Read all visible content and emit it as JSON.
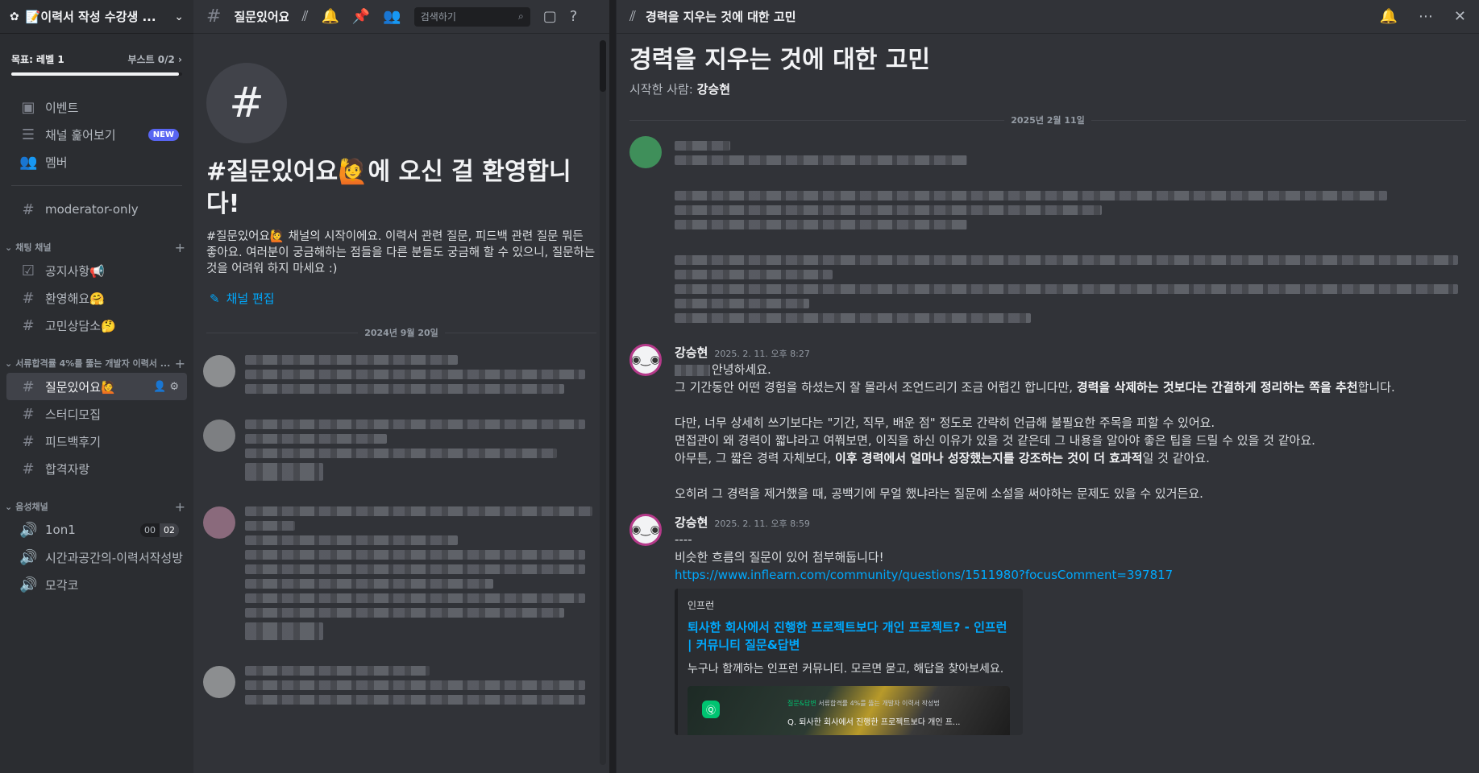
{
  "server": {
    "name": "📝이력서 작성 수강생 ...",
    "goal": "목표: 레벨 1",
    "boost": "부스트 0/2",
    "goal_progress": 0.98
  },
  "nav": [
    {
      "label": "이벤트",
      "icon": "calendar-icon"
    },
    {
      "label": "채널 훑어보기",
      "icon": "browse-icon",
      "badge": "NEW"
    },
    {
      "label": "멤버",
      "icon": "members-icon"
    }
  ],
  "mod_channel": "moderator-only",
  "categories": {
    "chat": {
      "label": "채팅 채널",
      "channels": [
        "공지사항📢",
        "환영해요🤗",
        "고민상담소🤔"
      ]
    },
    "dev": {
      "label": "서류합격률 4%를 뚫는 개발자 이력서 ...",
      "channels": [
        "질문있어요🙋",
        "스터디모집",
        "피드백후기",
        "합격자랑"
      ],
      "active": "질문있어요🙋"
    },
    "voice": {
      "label": "음성채널",
      "channels": [
        "1on1",
        "시간과공간의-이력서작성방",
        "모각코"
      ],
      "count_a": "00",
      "count_b": "02"
    }
  },
  "channel": {
    "title": "질문있어요",
    "search_placeholder": "검색하기",
    "welcome_title": "#질문있어요🙋에 오신 걸 환영합니다!",
    "welcome_desc": "#질문있어요🙋 채널의 시작이에요. 이력서 관련 질문, 피드백 관련 질문 뭐든 좋아요. 여러분이 궁금해하는 점들을 다른 분들도 궁금해 할 수 있으니, 질문하는 것을 어려워 하지 마세요 :)",
    "edit_label": "채널 편집",
    "date": "2024년 9월 20일"
  },
  "thread": {
    "header_title": "경력을 지우는 것에 대한 고민",
    "title": "경력을 지우는 것에 대한 고민",
    "starter_prefix": "시작한 사람:",
    "starter_name": "강승현",
    "date": "2025년 2월 11일",
    "messages": [
      {
        "author": "강승현",
        "time": "2025. 2. 11. 오후 8:27",
        "greeting": "안녕하세요.",
        "l1a": "그 기간동안 어떤 경험을 하셨는지 잘 몰라서 조언드리기 조금 어렵긴 합니다만, ",
        "l1b": "경력을 삭제하는 것보다는 간결하게 정리하는 쪽을 추천",
        "l1c": "합니다.",
        "l2": "다만, 너무 상세히 쓰기보다는 \"기간, 직무, 배운 점\" 정도로 간략히 언급해 불필요한 주목을 피할 수 있어요.",
        "l3": "면접관이 왜 경력이 짧냐라고 여쭤보면, 이직을 하신 이유가 있을 것 같은데 그 내용을 알아야 좋은 팁을 드릴 수 있을 것 같아요.",
        "l4a": "아무튼, 그 짧은 경력 자체보다, ",
        "l4b": "이후 경력에서 얼마나 성장했는지를 강조하는 것이 더 효과적",
        "l4c": "일 것 같아요.",
        "l5": "오히려 그 경력을 제거했을 때, 공백기에 무얼 했냐라는 질문에 소설을 써야하는 문제도 있을 수 있거든요."
      },
      {
        "author": "강승현",
        "time": "2025. 2. 11. 오후 8:59",
        "l1": "----",
        "l2": "비슷한 흐름의 질문이 있어 첨부해둡니다!",
        "link": "https://www.inflearn.com/community/questions/1511980?focusComment=397817",
        "embed": {
          "provider": "인프런",
          "title": "퇴사한 회사에서 진행한 프로젝트보다 개인 프로젝트? - 인프런 | 커뮤니티 질문&답변",
          "desc": "누구나 함께하는 인프런 커뮤니티. 모르면 묻고, 해답을 찾아보세요.",
          "img_tag": "질문&답변",
          "img_caption": "서류합격률 4%를 뚫는 개발자 이력서 작성법",
          "img_question": "Q. 퇴사한 회사에서 진행한 프로젝트보다 개인 프..."
        }
      }
    ]
  },
  "colors": {
    "bg": "#313338",
    "sidebar": "#2b2d31",
    "link": "#00a8fc",
    "badge": "#5865f2"
  }
}
